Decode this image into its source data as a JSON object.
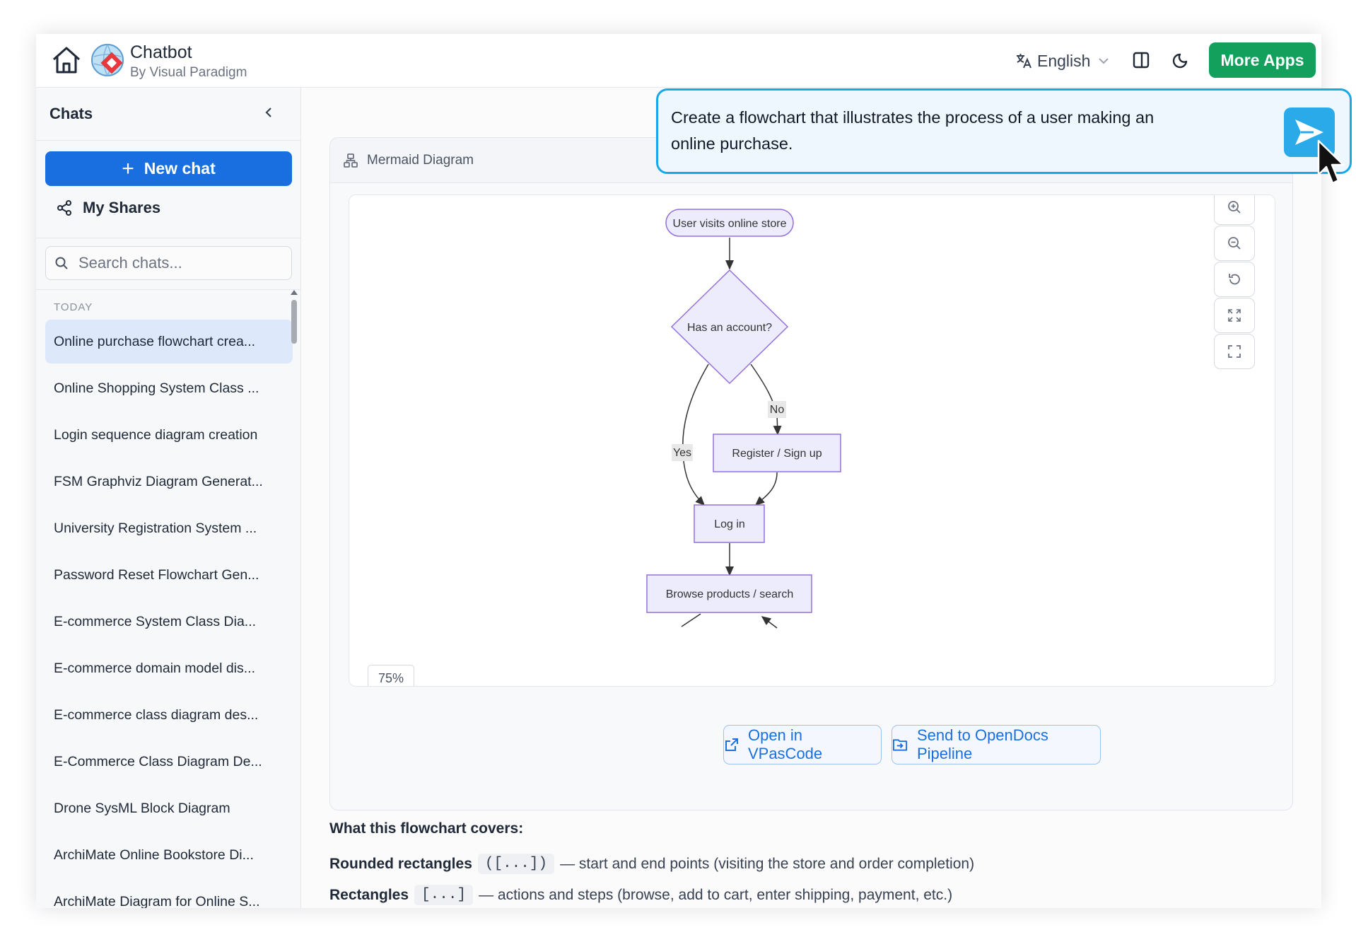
{
  "header": {
    "app_title": "Chatbot",
    "app_subtitle": "By Visual Paradigm",
    "language": "English",
    "more_apps": "More Apps"
  },
  "sidebar": {
    "title": "Chats",
    "new_chat": "New chat",
    "my_shares": "My Shares",
    "search_placeholder": "Search chats...",
    "group_label": "TODAY",
    "items": [
      {
        "label": "Online purchase flowchart crea...",
        "active": true
      },
      {
        "label": "Online Shopping System Class ..."
      },
      {
        "label": "Login sequence diagram creation"
      },
      {
        "label": "FSM Graphviz Diagram Generat..."
      },
      {
        "label": "University Registration System ..."
      },
      {
        "label": "Password Reset Flowchart Gen..."
      },
      {
        "label": "E-commerce System Class Dia..."
      },
      {
        "label": "E-commerce domain model dis..."
      },
      {
        "label": "E-commerce class diagram des..."
      },
      {
        "label": "E-Commerce Class Diagram De..."
      },
      {
        "label": "Drone SysML Block Diagram"
      },
      {
        "label": "ArchiMate Online Bookstore Di..."
      },
      {
        "label": "ArchiMate Diagram for Online S..."
      }
    ]
  },
  "card": {
    "title": "Mermaid Diagram",
    "zoom": "75%",
    "open_button": "Open in VPasCode",
    "send_button": "Send to OpenDocs Pipeline"
  },
  "flowchart": {
    "nodes": {
      "start": "User visits online store",
      "decision": "Has an account?",
      "register": "Register / Sign up",
      "login": "Log in",
      "browse": "Browse products / search"
    },
    "edges": {
      "yes": "Yes",
      "no": "No"
    }
  },
  "covers": {
    "title": "What this flowchart covers:",
    "lines": [
      {
        "term": "Rounded rectangles",
        "code": "([...])",
        "desc": "— start and end points (visiting the store and order completion)"
      },
      {
        "term": "Rectangles",
        "code": "[...]",
        "desc": "— actions and steps (browse, add to cart, enter shipping, payment, etc.)"
      }
    ]
  },
  "prompt": {
    "text": "Create a flowchart that illustrates the process of a user making an online purchase."
  },
  "icons": {
    "home": "home-icon",
    "logo": "visual-paradigm-logo",
    "language": "translate-icon",
    "panel": "panel-toggle-icon",
    "theme": "moon-icon",
    "send": "send-icon"
  },
  "colors": {
    "primary": "#1a6fe0",
    "more_apps": "#13a05d",
    "node_fill": "#ececfd",
    "node_stroke": "#9370db",
    "prompt_border": "#18a8e8"
  }
}
